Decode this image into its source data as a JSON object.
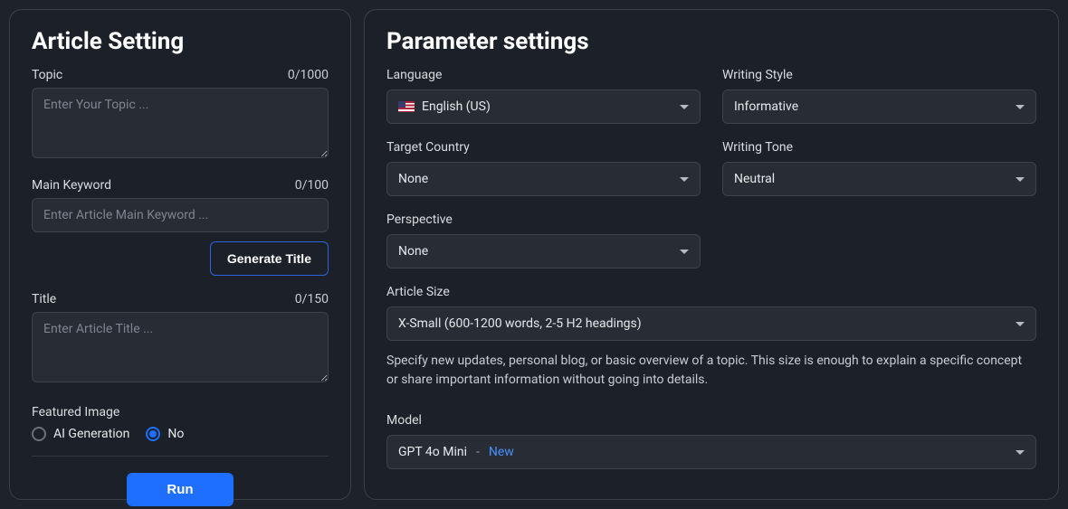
{
  "left": {
    "title": "Article Setting",
    "topic": {
      "label": "Topic",
      "counter": "0/1000",
      "placeholder": "Enter Your Topic ..."
    },
    "main_keyword": {
      "label": "Main Keyword",
      "counter": "0/100",
      "placeholder": "Enter Article Main Keyword ..."
    },
    "generate_title_button": "Generate Title",
    "title_field": {
      "label": "Title",
      "counter": "0/150",
      "placeholder": "Enter Article Title ..."
    },
    "featured_image": {
      "label": "Featured Image",
      "options": {
        "ai": "AI Generation",
        "no": "No"
      },
      "selected": "no"
    },
    "run_button": "Run"
  },
  "right": {
    "title": "Parameter settings",
    "language": {
      "label": "Language",
      "value": "English (US)"
    },
    "writing_style": {
      "label": "Writing Style",
      "value": "Informative"
    },
    "target_country": {
      "label": "Target Country",
      "value": "None"
    },
    "writing_tone": {
      "label": "Writing Tone",
      "value": "Neutral"
    },
    "perspective": {
      "label": "Perspective",
      "value": "None"
    },
    "article_size": {
      "label": "Article Size",
      "value": "X-Small (600-1200 words, 2-5 H2 headings)",
      "help": "Specify new updates, personal blog, or basic overview of a topic. This size is enough to explain a specific concept or share important information without going into details."
    },
    "model": {
      "label": "Model",
      "value_main": "GPT 4o Mini",
      "value_suffix": "New"
    }
  }
}
